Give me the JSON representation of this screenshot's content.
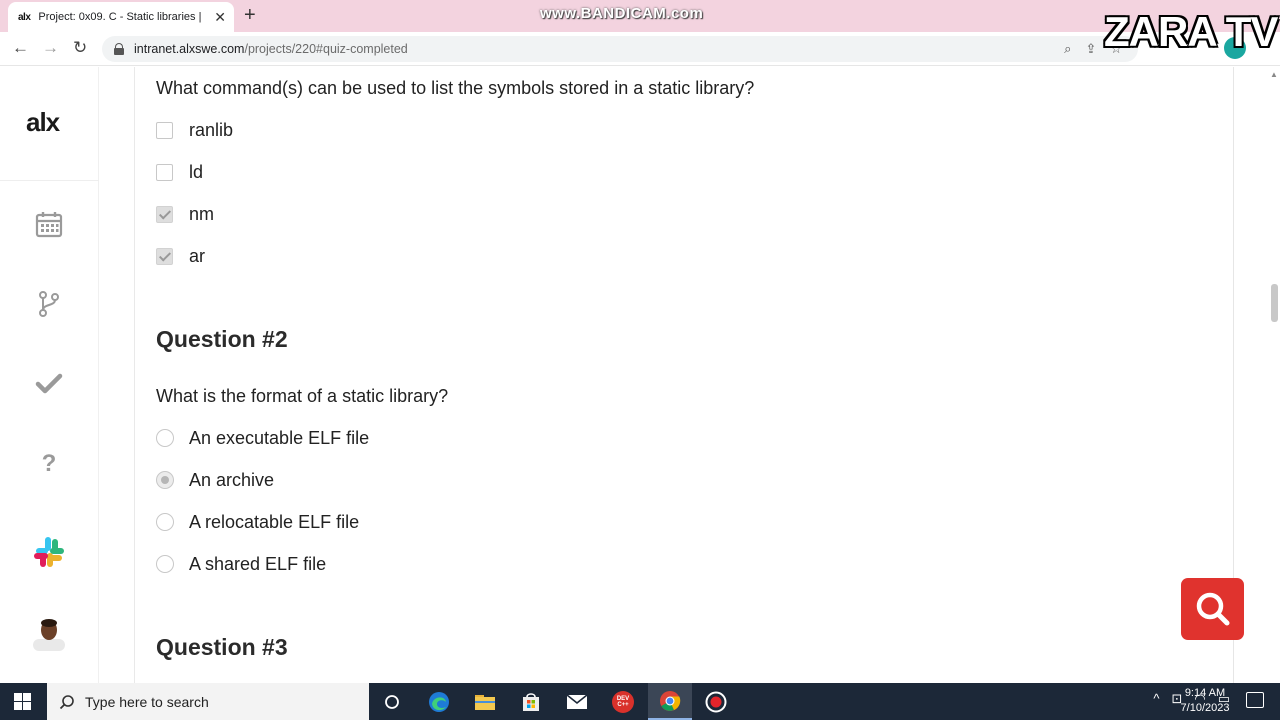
{
  "browser": {
    "tab_favicon": "alx",
    "tab_title": "Project: 0x09. C - Static libraries |",
    "url_host": "intranet.alxswe.com",
    "url_path": "/projects/220#quiz-completed",
    "watermark": "www.BANDICAM.com",
    "channel_overlay": "ZARA TV"
  },
  "sidebar": {
    "logo": "alx",
    "items": [
      {
        "icon": "calendar-icon"
      },
      {
        "icon": "git-branch-icon"
      },
      {
        "icon": "checkmark-icon"
      },
      {
        "icon": "question-mark-icon"
      },
      {
        "icon": "slack-icon"
      },
      {
        "icon": "avatar"
      }
    ]
  },
  "quiz": {
    "q1": {
      "text": "What command(s) can be used to list the symbols stored in a static library?",
      "options": [
        {
          "label": "ranlib",
          "checked": false
        },
        {
          "label": "ld",
          "checked": false
        },
        {
          "label": "nm",
          "checked": true
        },
        {
          "label": "ar",
          "checked": true
        }
      ]
    },
    "q2": {
      "heading": "Question #2",
      "text": "What is the format of a static library?",
      "options": [
        {
          "label": "An executable ELF file",
          "checked": false
        },
        {
          "label": "An archive",
          "checked": true
        },
        {
          "label": "A relocatable ELF file",
          "checked": false
        },
        {
          "label": "A shared ELF file",
          "checked": false
        }
      ]
    },
    "q3": {
      "heading": "Question #3"
    }
  },
  "taskbar": {
    "search_placeholder": "Type here to search",
    "time": "9:14 AM",
    "date": "7/10/2023",
    "dev_label": "DEV C++"
  },
  "colors": {
    "tabstrip": "#f3d3df",
    "fab": "#e0332e",
    "taskbar": "#1c2838"
  }
}
